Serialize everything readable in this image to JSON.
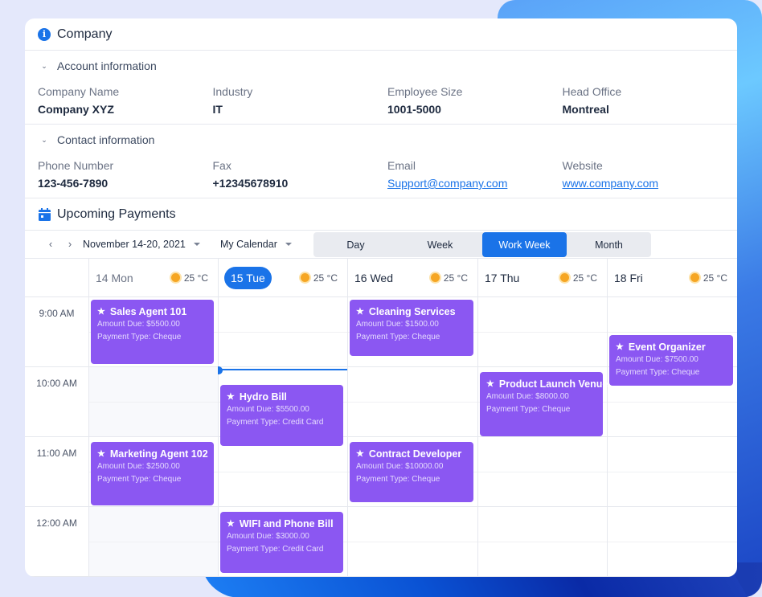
{
  "company": {
    "title": "Company",
    "account": {
      "title": "Account information",
      "fields": [
        {
          "label": "Company Name",
          "value": "Company XYZ"
        },
        {
          "label": "Industry",
          "value": "IT"
        },
        {
          "label": "Employee Size",
          "value": "1001-5000"
        },
        {
          "label": "Head Office",
          "value": "Montreal"
        }
      ]
    },
    "contact": {
      "title": "Contact information",
      "fields": [
        {
          "label": "Phone Number",
          "value": "123-456-7890"
        },
        {
          "label": "Fax",
          "value": "+12345678910"
        },
        {
          "label": "Email",
          "value": "Support@company.com"
        },
        {
          "label": "Website",
          "value": "www.company.com"
        }
      ]
    }
  },
  "payments": {
    "title": "Upcoming Payments",
    "toolbar": {
      "prev_icon": "chevron-left-icon",
      "next_icon": "chevron-right-icon",
      "date_range": "November 14-20, 2021",
      "calendar": "My Calendar",
      "views": [
        "Day",
        "Week",
        "Work Week",
        "Month"
      ],
      "active_view": "Work Week"
    },
    "days": [
      {
        "label": "14 Mon",
        "weather": "25 °C",
        "today": false
      },
      {
        "label": "15 Tue",
        "weather": "25 °C",
        "today": true
      },
      {
        "label": "16 Wed",
        "weather": "25 °C",
        "today": false
      },
      {
        "label": "17 Thu",
        "weather": "25 °C",
        "today": false
      },
      {
        "label": "18 Fri",
        "weather": "25 °C",
        "today": false
      }
    ],
    "times": [
      "9:00 AM",
      "10:00 AM",
      "11:00 AM",
      "12:00 AM"
    ],
    "events": [
      {
        "title": "Sales Agent 101",
        "amount": "Amount Due: $5500.00",
        "type": "Payment Type: Cheque",
        "day": 0,
        "start": 0.0,
        "end": 0.92
      },
      {
        "title": "Cleaning Services",
        "amount": "Amount Due: $1500.00",
        "type": "Payment Type: Cheque",
        "day": 2,
        "start": 0.0,
        "end": 0.8
      },
      {
        "title": "Event Organizer",
        "amount": "Amount Due: $7500.00",
        "type": "Payment Type: Cheque",
        "day": 4,
        "start": 0.5,
        "end": 1.23
      },
      {
        "title": "Hydro Bill",
        "amount": "Amount Due: $5500.00",
        "type": "Payment Type: Credit Card",
        "day": 1,
        "start": 1.22,
        "end": 2.09
      },
      {
        "title": "Product Launch Venue",
        "amount": "Amount Due: $8000.00",
        "type": "Payment Type: Cheque",
        "day": 3,
        "start": 1.03,
        "end": 1.95
      },
      {
        "title": "Marketing Agent 102",
        "amount": "Amount Due: $2500.00",
        "type": "Payment Type: Cheque",
        "day": 0,
        "start": 2.03,
        "end": 2.94
      },
      {
        "title": "Contract Developer",
        "amount": "Amount Due: $10000.00",
        "type": "Payment Type: Cheque",
        "day": 2,
        "start": 2.03,
        "end": 2.9
      },
      {
        "title": "WIFI and Phone Bill",
        "amount": "Amount Due: $3000.00",
        "type": "Payment Type: Credit Card",
        "day": 1,
        "start": 3.04,
        "end": 3.91
      }
    ],
    "current_time_offset_hours": 1.1,
    "colors": {
      "event": "#8b57f2",
      "accent": "#1a73e8"
    }
  }
}
